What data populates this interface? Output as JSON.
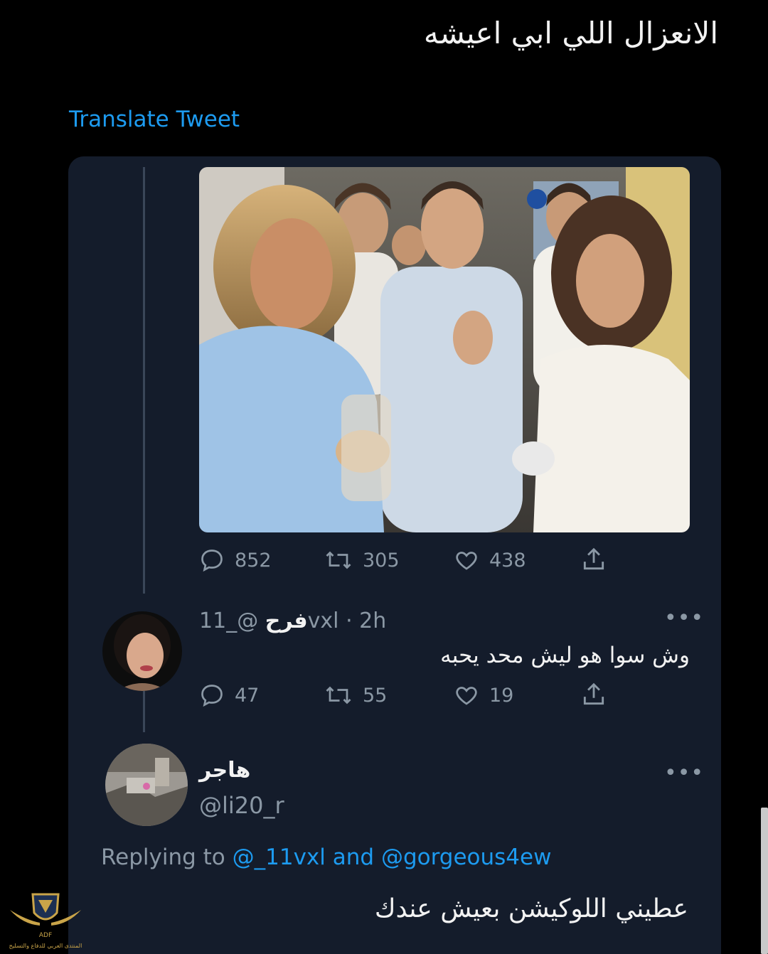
{
  "tweet": {
    "text": "الانعزال اللي ابي اعيشه",
    "translate_label": "Translate Tweet"
  },
  "quoted_tweet": {
    "stats": {
      "replies": "852",
      "retweets": "305",
      "likes": "438"
    }
  },
  "reply1": {
    "display_name": "فرح",
    "handle": "@_11vxl",
    "separator": "·",
    "time": "2h",
    "text": "وش سوا هو ليش محد يحبه",
    "stats": {
      "replies": "47",
      "retweets": "55",
      "likes": "19"
    }
  },
  "reply2": {
    "display_name": "هاجر",
    "handle": "@li20_r",
    "replying_prefix": "Replying to",
    "mention1": "@_11vxl",
    "and_word": "and",
    "mention2": "@gorgeous4ew",
    "text": "عطيني اللوكيشن بعيش عندك"
  },
  "watermark": {
    "text": "المنتدى العربي للدفاع والتسليح"
  },
  "icons": {
    "reply": "reply-icon",
    "retweet": "retweet-icon",
    "like": "heart-icon",
    "share": "share-icon",
    "more": "more-icon"
  },
  "colors": {
    "background": "#000000",
    "card": "#141c2b",
    "link": "#1d9bf0",
    "muted": "#8b98a5",
    "text": "#f2f2f2"
  }
}
